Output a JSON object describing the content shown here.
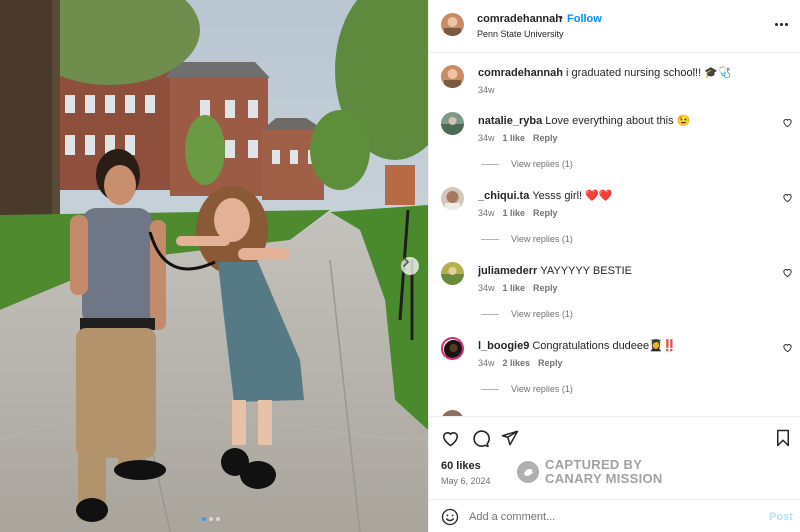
{
  "post": {
    "author": "comradehannah",
    "follow_label": "Follow",
    "header_separator": "•",
    "location": "Penn State University",
    "caption_user": "comradehannah",
    "caption_text": "i graduated nursing school!! 🎓🩺",
    "caption_time": "34w"
  },
  "comments": [
    {
      "user": "natalie_ryba",
      "text": "Love everything about this 😉",
      "time": "34w",
      "likes": "1 like",
      "reply": "Reply",
      "view_replies": "View replies (1)"
    },
    {
      "user": "_chiqui.ta",
      "text": "Yesss girl! ❤️❤️",
      "time": "34w",
      "likes": "1 like",
      "reply": "Reply",
      "view_replies": "View replies (1)"
    },
    {
      "user": "juliamederr",
      "text": "YAYYYYY BESTIE",
      "time": "34w",
      "likes": "1 like",
      "reply": "Reply",
      "view_replies": "View replies (1)"
    },
    {
      "user": "l_boogie9",
      "text": "Congratulations dudeee👩‍🎓‼️",
      "time": "34w",
      "likes": "2 likes",
      "reply": "Reply",
      "view_replies": "View replies (1)"
    }
  ],
  "actions": {
    "likes": "60 likes",
    "date": "May 6, 2024",
    "icons": [
      "heart-icon",
      "comment-icon",
      "share-icon",
      "bookmark-icon"
    ]
  },
  "watermark": {
    "line1": "CAPTURED BY",
    "line2": "CANARY MISSION"
  },
  "add_comment": {
    "placeholder": "Add a comment...",
    "post_label": "Post"
  },
  "carousel": {
    "slide_count": 3,
    "active_index": 0
  },
  "colors": {
    "accent": "#0095f6",
    "post_disabled": "#b2dffc",
    "story_ring": "#d62976"
  }
}
